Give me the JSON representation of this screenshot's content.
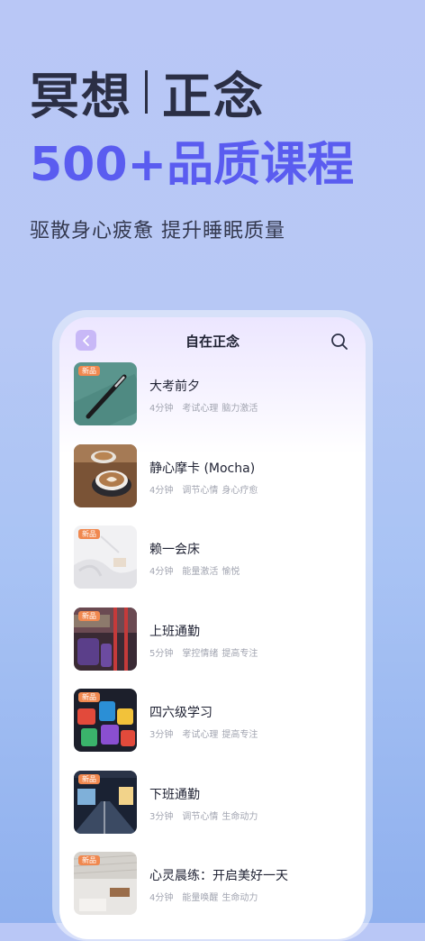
{
  "hero": {
    "title_part1": "冥想",
    "title_part2": "正念",
    "headline": "500+品质课程",
    "subtitle": "驱散身心疲惫  提升睡眠质量"
  },
  "app": {
    "title": "自在正念",
    "back_icon": "chevron-left-icon",
    "search_icon": "search-icon"
  },
  "courses": [
    {
      "title": "大考前夕",
      "duration": "4分钟",
      "tags": [
        "考试心理",
        "脑力激活"
      ],
      "badge": "新品"
    },
    {
      "title": "静心摩卡 (Mocha)",
      "duration": "4分钟",
      "tags": [
        "调节心情",
        "身心疗愈"
      ],
      "badge": ""
    },
    {
      "title": "赖一会床",
      "duration": "4分钟",
      "tags": [
        "能量激活",
        "愉悦"
      ],
      "badge": "新品"
    },
    {
      "title": "上班通勤",
      "duration": "5分钟",
      "tags": [
        "掌控情绪",
        "提高专注"
      ],
      "badge": "新品"
    },
    {
      "title": "四六级学习",
      "duration": "3分钟",
      "tags": [
        "考试心理",
        "提高专注"
      ],
      "badge": "新品"
    },
    {
      "title": "下班通勤",
      "duration": "3分钟",
      "tags": [
        "调节心情",
        "生命动力"
      ],
      "badge": "新品"
    },
    {
      "title": "心灵晨练：开启美好一天",
      "duration": "4分钟",
      "tags": [
        "能量唤醒",
        "生命动力"
      ],
      "badge": "新品"
    }
  ],
  "colors": {
    "accent": "#5a5cf0",
    "badge": "#f0884f",
    "back_button": "#c8b8f7"
  }
}
